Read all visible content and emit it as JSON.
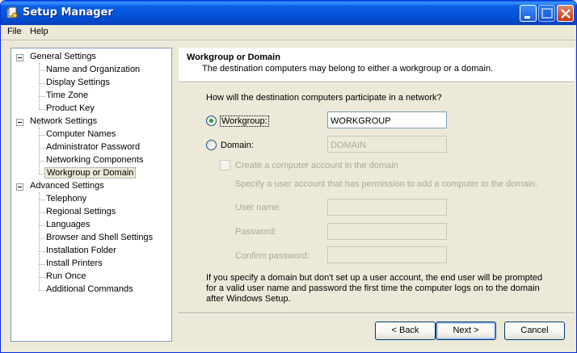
{
  "window": {
    "title": "Setup Manager"
  },
  "menu": [
    "File",
    "Help"
  ],
  "tree": {
    "groups": [
      {
        "label": "General Settings",
        "items": [
          "Name and Organization",
          "Display Settings",
          "Time Zone",
          "Product Key"
        ]
      },
      {
        "label": "Network Settings",
        "items": [
          "Computer Names",
          "Administrator Password",
          "Networking Components",
          "Workgroup or Domain"
        ]
      },
      {
        "label": "Advanced Settings",
        "items": [
          "Telephony",
          "Regional Settings",
          "Languages",
          "Browser and Shell Settings",
          "Installation Folder",
          "Install Printers",
          "Run Once",
          "Additional Commands"
        ]
      }
    ],
    "selected": "Workgroup or Domain"
  },
  "page": {
    "title": "Workgroup or Domain",
    "subtitle": "The destination computers may belong to either a workgroup or a domain.",
    "question": "How will the destination computers participate in a network?",
    "workgroup_label": "Workgroup:",
    "workgroup_value": "WORKGROUP",
    "workgroup_selected": true,
    "domain_label": "Domain:",
    "domain_value": "DOMAIN",
    "create_account_label": "Create a computer account in the domain",
    "specify_text": "Specify a user account that has permission to add a computer to the domain.",
    "username_label": "User name:",
    "password_label": "Password:",
    "confirm_label": "Confirm password:",
    "note_line1": "If you specify a domain but don't set up a user account, the end user will be prompted",
    "note_line2": "for a valid user name and password the first time the computer logs on to the domain",
    "note_line3": "after Windows Setup."
  },
  "buttons": {
    "back": "< Back",
    "next": "Next >",
    "cancel": "Cancel"
  }
}
